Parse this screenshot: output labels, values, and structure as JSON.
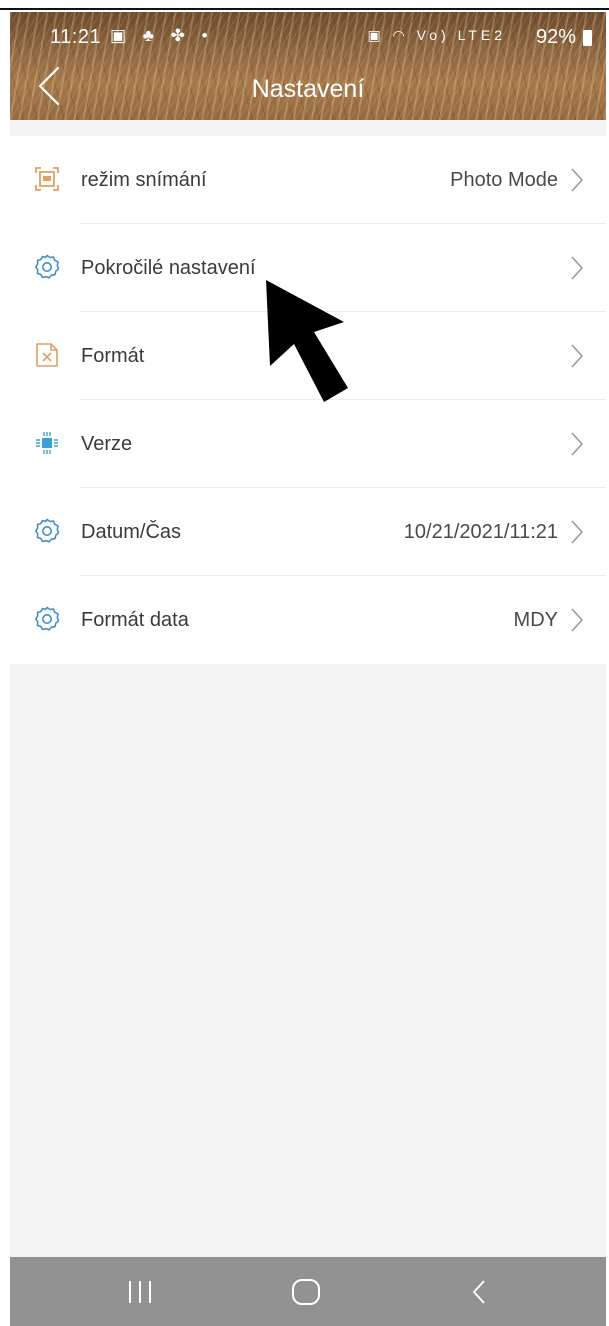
{
  "status_bar": {
    "time": "11:21",
    "left_icons": "▣ ♣ ✤ •",
    "right_icons": "▣ ◠ Vo) LTE2",
    "battery": "92%"
  },
  "header": {
    "title": "Nastavení",
    "back_icon": "chevron-left-icon"
  },
  "settings": [
    {
      "label": "režim snímání",
      "value": "Photo Mode",
      "icon": "capture-mode-icon"
    },
    {
      "label": "Pokročilé nastavení",
      "value": "",
      "icon": "gear-icon"
    },
    {
      "label": "Formát",
      "value": "",
      "icon": "format-file-icon"
    },
    {
      "label": "Verze",
      "value": "",
      "icon": "chip-icon"
    },
    {
      "label": "Datum/Čas",
      "value": "10/21/2021/11:21",
      "icon": "gear-icon"
    },
    {
      "label": "Formát data",
      "value": "MDY",
      "icon": "gear-icon"
    }
  ],
  "system_nav": {
    "recent_icon": "recent-apps-icon",
    "home_icon": "home-icon",
    "back_icon": "back-icon"
  },
  "colors": {
    "accent_icon": "#e0a064",
    "gear_icon": "#3f8fc2",
    "chip_icon": "#3aa0d8",
    "background": "#f3f3f3",
    "system_nav": "#929292"
  }
}
